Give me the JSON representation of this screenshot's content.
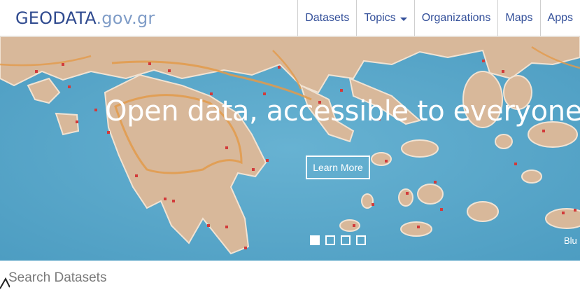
{
  "header": {
    "brand_main": "GEODATA",
    "brand_tld": ".gov.gr",
    "nav": [
      {
        "label": "Datasets"
      },
      {
        "label": "Topics"
      },
      {
        "label": "Organizations"
      },
      {
        "label": "Maps"
      },
      {
        "label": "Apps"
      }
    ]
  },
  "hero": {
    "title": "Open data, accessible to everyone!",
    "button_label": "Learn More",
    "caption": "Blu",
    "carousel": {
      "slide_count": 4,
      "active_index": 0
    }
  },
  "search": {
    "placeholder": "Search Datasets"
  },
  "colors": {
    "brand": "#2f4a8f",
    "brand_tld": "#7f9cc7",
    "nav_text": "#34509a",
    "sea": "#5aa7c9",
    "land": "#d8b89a",
    "road": "#e39a4a",
    "marker": "#d23a3a"
  }
}
